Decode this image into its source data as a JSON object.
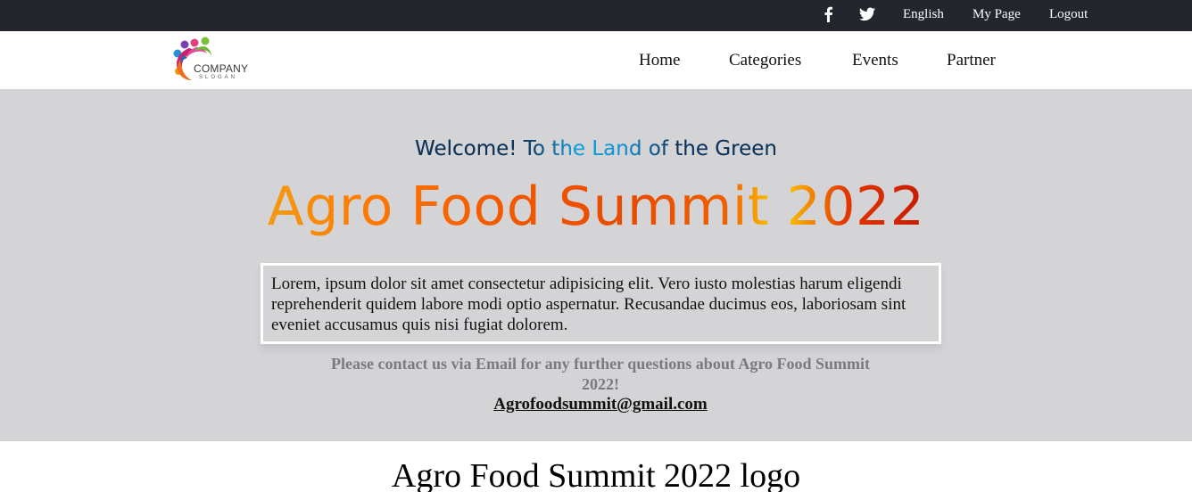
{
  "topbar": {
    "icons": [
      "facebook-icon",
      "twitter-icon"
    ],
    "links": [
      "English",
      "My Page",
      "Logout"
    ]
  },
  "logo": {
    "company": "COMPANY",
    "slogan": "SLOGAN"
  },
  "nav": {
    "items": [
      "Home",
      "Categories",
      "Events",
      "Partner"
    ]
  },
  "hero": {
    "welcome": "Welcome! To the Land of the Green",
    "title": "Agro Food Summit 2022",
    "description": "Lorem, ipsum dolor sit amet consectetur adipisicing elit. Vero iusto molestias harum eligendi reprehenderit quidem labore modi optio aspernatur. Recusandae ducimus eos, laboriosam sint eveniet accusamus quis nisi fugiat dolorem.",
    "contact": "Please contact us via Email for any further questions about Agro Food Summit 2022!",
    "email": "Agrofoodsummit@gmail.com"
  },
  "section": {
    "title": "Agro Food Summit 2022 logo"
  },
  "colors": {
    "topbar_bg": "#24262e",
    "hero_bg": "#d4d4d7",
    "welcome_text": "#0f3358",
    "title_orange": "#f25a00",
    "contact_text": "#7b7b7d"
  }
}
